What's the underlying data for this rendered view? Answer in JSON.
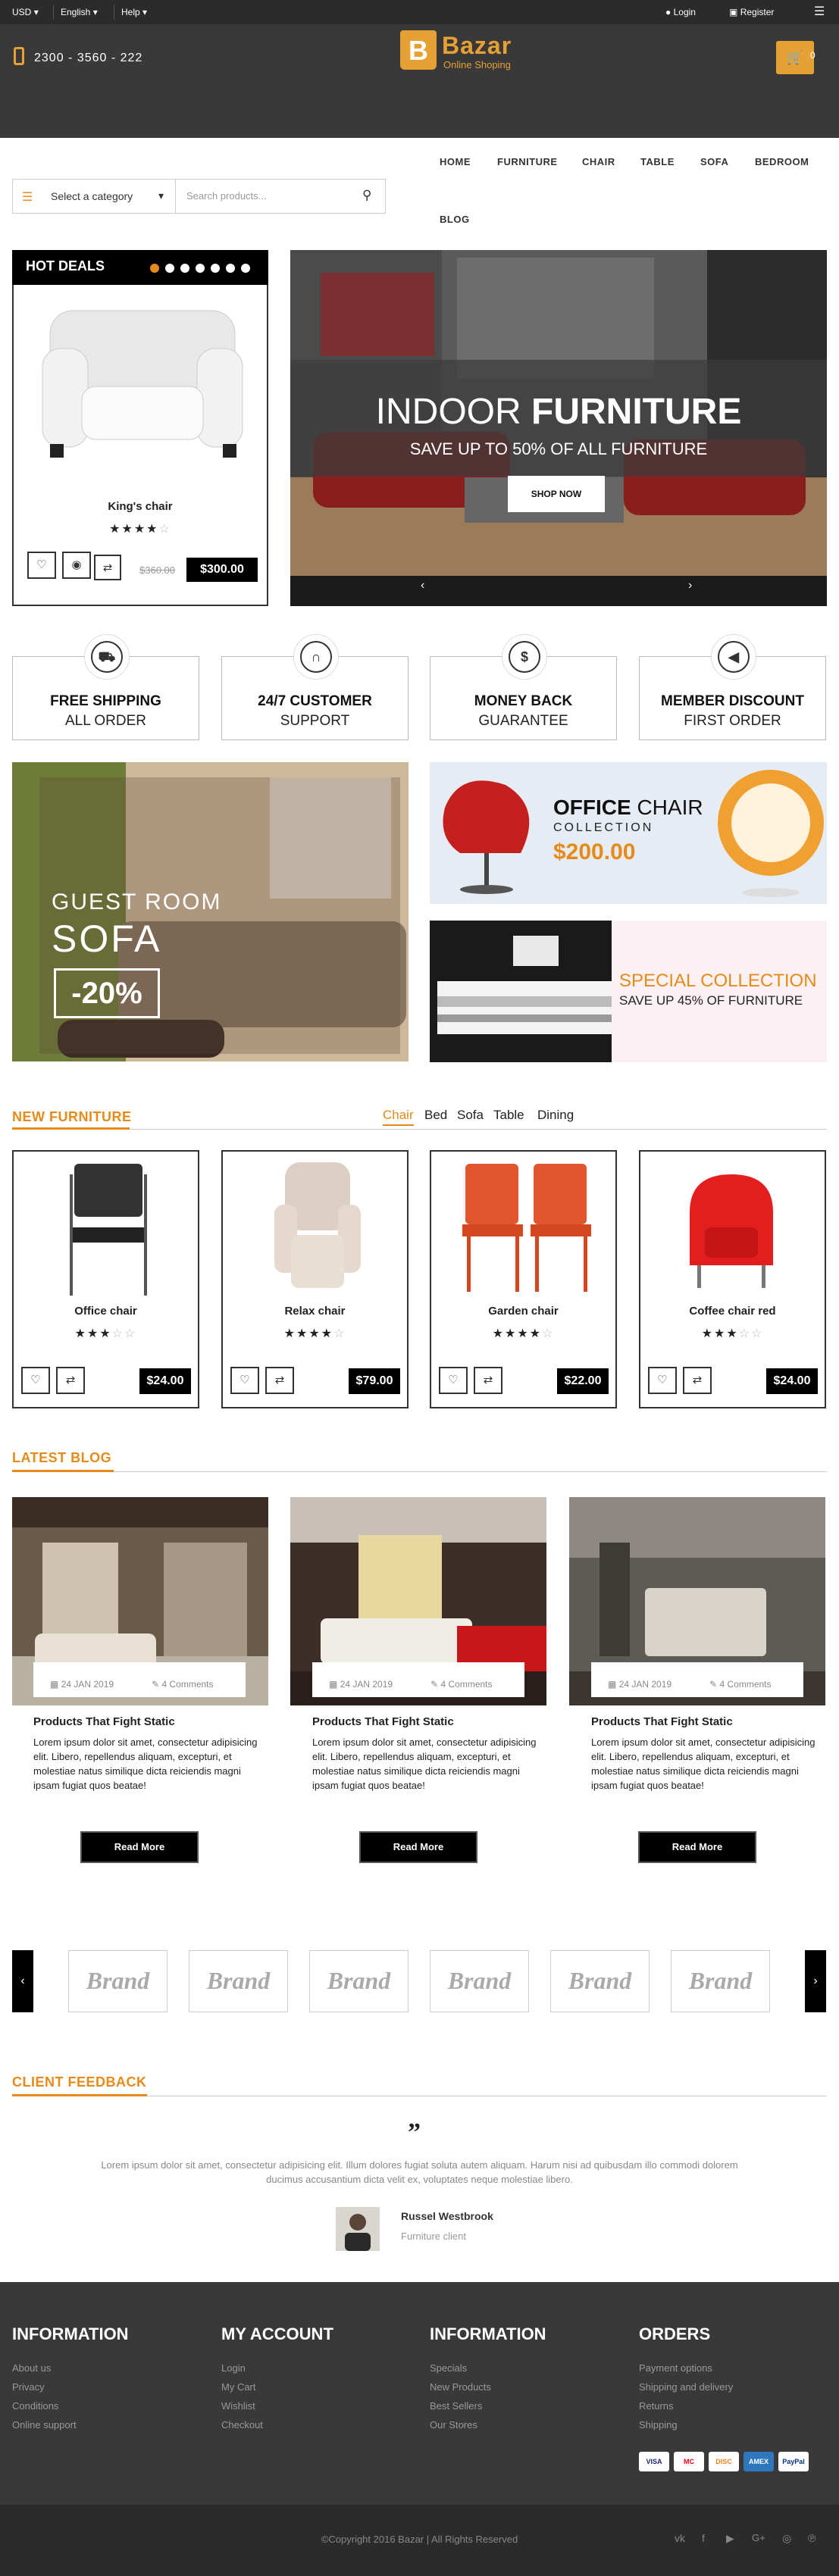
{
  "topbar": {
    "currency": "USD",
    "language": "English",
    "help": "Help",
    "login": "Login",
    "register": "Register"
  },
  "header": {
    "phone": "2300 - 3560 - 222",
    "logo_title": "Bazar",
    "logo_subtitle": "Online Shoping",
    "cart_count": "0"
  },
  "search": {
    "category_label": "Select a category",
    "placeholder": "Search products..."
  },
  "nav": [
    "HOME",
    "FURNITURE",
    "CHAIR",
    "TABLE",
    "SOFA",
    "BEDROOM",
    "BLOG"
  ],
  "hot_deals": {
    "title": "HOT DEALS",
    "product_name": "King's chair",
    "rating": 4,
    "old_price": "$360.00",
    "price": "$300.00"
  },
  "hero": {
    "title_light": "INDOOR",
    "title_bold": "FURNITURE",
    "subtitle": "SAVE UP TO 50% OF ALL FURNITURE",
    "button": "SHOP NOW"
  },
  "features": [
    {
      "icon": "truck-icon",
      "line1": "FREE SHIPPING",
      "line2": "ALL ORDER"
    },
    {
      "icon": "headphones-icon",
      "line1": "24/7 CUSTOMER",
      "line2": "SUPPORT"
    },
    {
      "icon": "dollar-icon",
      "line1": "MONEY BACK",
      "line2": "GUARANTEE"
    },
    {
      "icon": "megaphone-icon",
      "line1": "MEMBER DISCOUNT",
      "line2": "FIRST ORDER"
    }
  ],
  "banners": {
    "sofa": {
      "line1": "GUEST ROOM",
      "line2": "SOFA",
      "discount": "-20%"
    },
    "office": {
      "title_bold": "OFFICE",
      "title_light": "CHAIR",
      "subtitle": "COLLECTION",
      "price": "$200.00"
    },
    "special": {
      "title": "SPECIAL COLLECTION",
      "subtitle": "SAVE UP 45% OF FURNITURE"
    }
  },
  "new_furniture": {
    "title": "NEW FURNITURE",
    "tabs": [
      "Chair",
      "Bed",
      "Sofa",
      "Table",
      "Dining"
    ],
    "active_tab": "Chair",
    "products": [
      {
        "name": "Office chair",
        "rating": 3,
        "price": "$24.00"
      },
      {
        "name": "Relax chair",
        "rating": 4,
        "price": "$79.00"
      },
      {
        "name": "Garden chair",
        "rating": 4,
        "price": "$22.00"
      },
      {
        "name": "Coffee chair red",
        "rating": 3,
        "price": "$24.00"
      }
    ]
  },
  "blog": {
    "title": "LATEST BLOG",
    "posts": [
      {
        "date": "24 JAN 2019",
        "comments": "4 Comments",
        "title": "Products That Fight Static",
        "text": "Lorem ipsum dolor sit amet, consectetur adipisicing elit. Libero, repellendus aliquam, excepturi, et molestiae natus similique dicta reiciendis magni ipsam fugiat quos beatae!",
        "button": "Read More"
      },
      {
        "date": "24 JAN 2019",
        "comments": "4 Comments",
        "title": "Products That Fight Static",
        "text": "Lorem ipsum dolor sit amet, consectetur adipisicing elit. Libero, repellendus aliquam, excepturi, et molestiae natus similique dicta reiciendis magni ipsam fugiat quos beatae!",
        "button": "Read More"
      },
      {
        "date": "24 JAN 2019",
        "comments": "4 Comments",
        "title": "Products That Fight Static",
        "text": "Lorem ipsum dolor sit amet, consectetur adipisicing elit. Libero, repellendus aliquam, excepturi, et molestiae natus similique dicta reiciendis magni ipsam fugiat quos beatae!",
        "button": "Read More"
      }
    ]
  },
  "brands": [
    "Brand",
    "Brand",
    "Brand",
    "Brand",
    "Brand",
    "Brand"
  ],
  "feedback": {
    "title": "CLIENT FEEDBACK",
    "quote": "Lorem ipsum dolor sit amet, consectetur adipisicing elit. Illum dolores fugiat soluta autem aliquam. Harum nisi ad quibusdam illo commodi dolorem ducimus accusantium dicta velit ex, voluptates neque molestiae libero.",
    "name": "Russel Westbrook",
    "role": "Furniture client"
  },
  "footer": {
    "columns": [
      {
        "title": "INFORMATION",
        "links": [
          "About us",
          "Privacy",
          "Conditions",
          "Online support"
        ]
      },
      {
        "title": "MY ACCOUNT",
        "links": [
          "Login",
          "My Cart",
          "Wishlist",
          "Checkout"
        ]
      },
      {
        "title": "INFORMATION",
        "links": [
          "Specials",
          "New Products",
          "Best Sellers",
          "Our Stores"
        ]
      },
      {
        "title": "ORDERS",
        "links": [
          "Payment options",
          "Shipping and delivery",
          "Returns",
          "Shipping"
        ]
      }
    ],
    "payments": [
      "VISA",
      "MC",
      "DISC",
      "AMEX",
      "PayPal"
    ],
    "copyright": "©Copyright 2016 Bazar | All Rights Reserved"
  },
  "colors": {
    "accent": "#e6a034",
    "dark": "#393939",
    "black": "#000000"
  }
}
